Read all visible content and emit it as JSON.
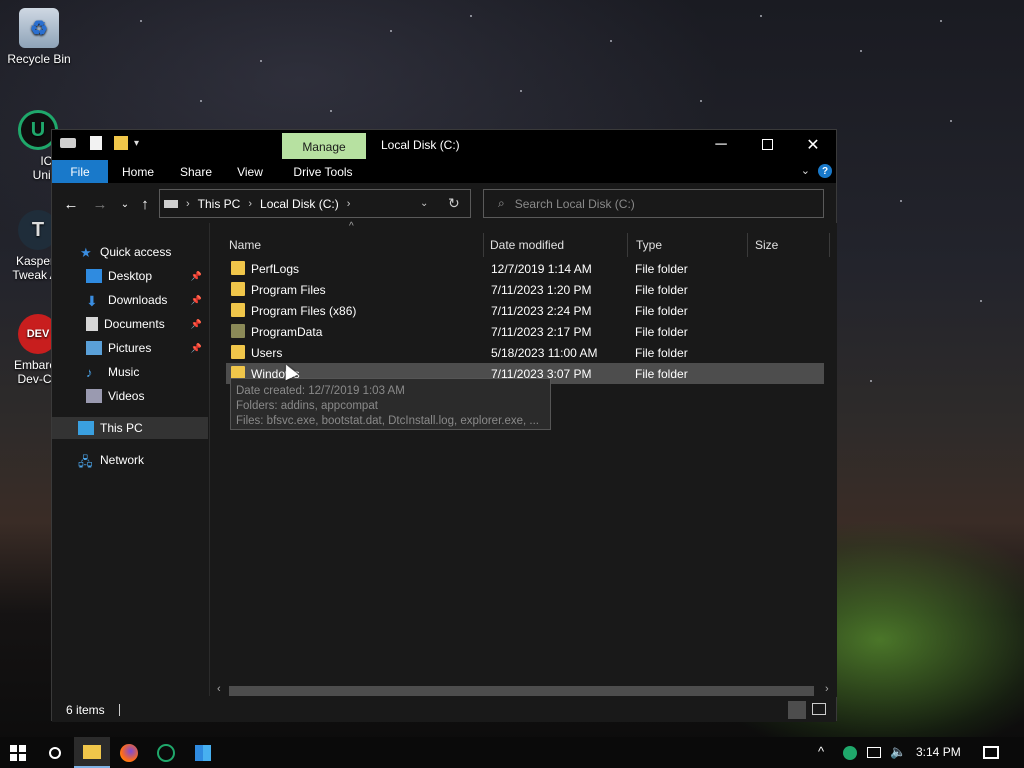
{
  "desktop": {
    "icons": [
      {
        "label": "Recycle Bin"
      },
      {
        "label": "IObit Uninsta"
      },
      {
        "label": "Kaspers Tweak As"
      },
      {
        "label": "Embarca Dev-C+"
      }
    ]
  },
  "window": {
    "title": "Local Disk (C:)",
    "manage_tab": "Manage",
    "ribbon_tabs": [
      "File",
      "Home",
      "Share",
      "View",
      "Drive Tools"
    ],
    "breadcrumb": [
      "This PC",
      "Local Disk (C:)"
    ],
    "search_placeholder": "Search Local Disk (C:)"
  },
  "sidebar": {
    "items": [
      {
        "label": "Quick access",
        "icon": "star-icon"
      },
      {
        "label": "Desktop",
        "icon": "desktop-icon",
        "pinned": true
      },
      {
        "label": "Downloads",
        "icon": "download-icon",
        "pinned": true
      },
      {
        "label": "Documents",
        "icon": "document-icon",
        "pinned": true
      },
      {
        "label": "Pictures",
        "icon": "picture-icon",
        "pinned": true
      },
      {
        "label": "Music",
        "icon": "music-icon"
      },
      {
        "label": "Videos",
        "icon": "video-icon"
      },
      {
        "label": "This PC",
        "icon": "computer-icon",
        "selected": true
      },
      {
        "label": "Network",
        "icon": "network-icon"
      }
    ]
  },
  "columns": [
    "Name",
    "Date modified",
    "Type",
    "Size"
  ],
  "files": [
    {
      "name": "PerfLogs",
      "date": "12/7/2019 1:14 AM",
      "type": "File folder"
    },
    {
      "name": "Program Files",
      "date": "7/11/2023 1:20 PM",
      "type": "File folder"
    },
    {
      "name": "Program Files (x86)",
      "date": "7/11/2023 2:24 PM",
      "type": "File folder"
    },
    {
      "name": "ProgramData",
      "date": "7/11/2023 2:17 PM",
      "type": "File folder"
    },
    {
      "name": "Users",
      "date": "5/18/2023 11:00 AM",
      "type": "File folder"
    },
    {
      "name": "Windows",
      "date": "7/11/2023 3:07 PM",
      "type": "File folder"
    }
  ],
  "tooltip": {
    "line1": "Date created: 12/7/2019 1:03 AM",
    "line2": "Folders: addins, appcompat",
    "line3": "Files: bfsvc.exe, bootstat.dat, DtcInstall.log, explorer.exe, ..."
  },
  "status": {
    "items": "6 items"
  },
  "taskbar": {
    "time": "3:14 PM"
  }
}
